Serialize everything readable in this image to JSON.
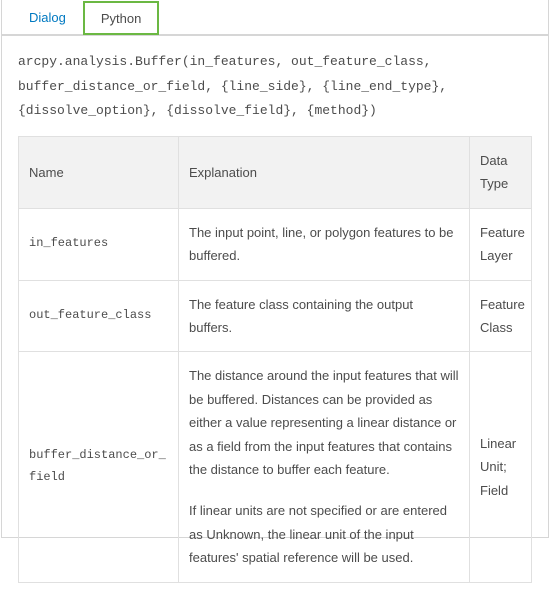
{
  "tabs": {
    "dialog": "Dialog",
    "python": "Python"
  },
  "syntax": "arcpy.analysis.Buffer(in_features, out_feature_class, buffer_distance_or_field, {line_side}, {line_end_type}, {dissolve_option}, {dissolve_field}, {method})",
  "headers": {
    "name": "Name",
    "explanation": "Explanation",
    "datatype": "Data Type"
  },
  "params": [
    {
      "name": "in_features",
      "explain": "The input point, line, or polygon features to be buffered.",
      "type": "Feature Layer"
    },
    {
      "name": "out_feature_class",
      "explain": "The feature class containing the output buffers.",
      "type": "Feature Class"
    },
    {
      "name": "buffer_distance_or_field",
      "explain1": "The distance around the input features that will be buffered. Distances can be provided as either a value representing a linear distance or as a field from the input features that contains the distance to buffer each feature.",
      "explain2": "If linear units are not specified or are entered as Unknown, the linear unit of the input features' spatial reference will be used.",
      "type": "Linear Unit; Field"
    }
  ]
}
